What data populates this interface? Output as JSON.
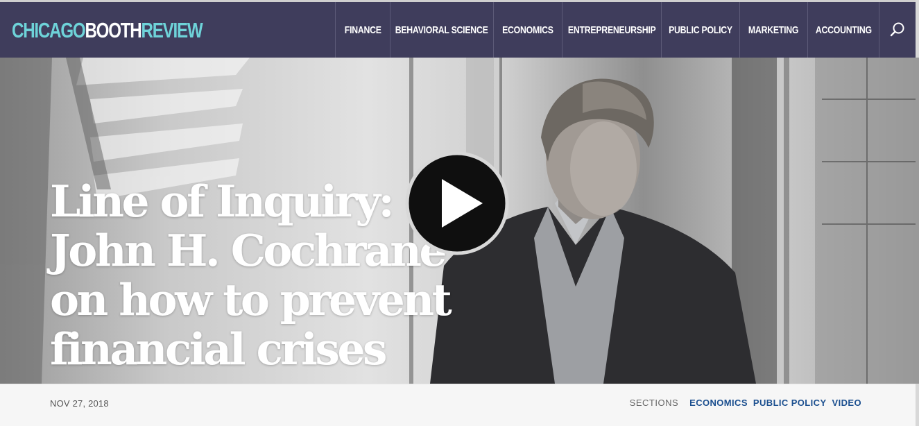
{
  "header": {
    "logo": {
      "part1": "CHICAGO",
      "part2": "BOOTH",
      "part3": "REVIEW"
    },
    "nav": [
      {
        "label": "FINANCE"
      },
      {
        "label": "BEHAVIORAL SCIENCE"
      },
      {
        "label": "ECONOMICS"
      },
      {
        "label": "ENTREPRENEURSHIP"
      },
      {
        "label": "PUBLIC POLICY"
      },
      {
        "label": "MARKETING"
      },
      {
        "label": "ACCOUNTING"
      }
    ],
    "search_icon": "search-icon"
  },
  "hero": {
    "headline": "Line of Inquiry: John H. Cochrane on how to prevent financial crises",
    "play_icon": "play-icon"
  },
  "meta": {
    "date": "NOV 27, 2018",
    "sections_label": "SECTIONS",
    "tags": [
      "ECONOMICS",
      "PUBLIC POLICY",
      "VIDEO"
    ]
  },
  "colors": {
    "navbar_bg": "#3f3d5c",
    "logo_accent": "#6ed3d9",
    "tag_link": "#1b4f8f"
  }
}
